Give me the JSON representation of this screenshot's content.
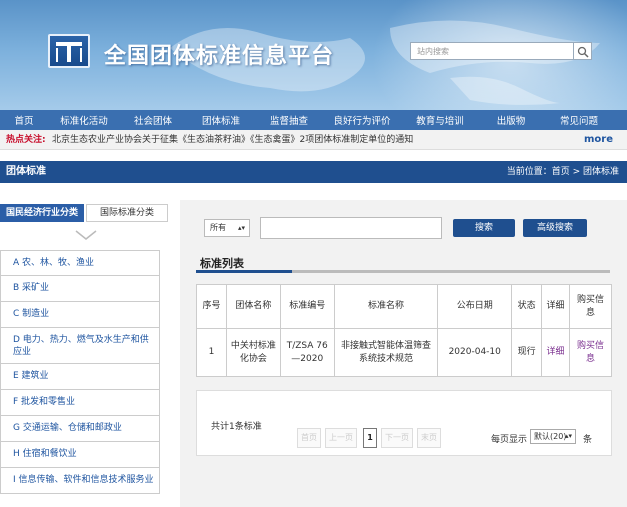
{
  "header": {
    "site_title": "全国团体标准信息平台",
    "search_placeholder": "站内搜索"
  },
  "nav": {
    "items": [
      "首页",
      "标准化活动",
      "社会团体",
      "团体标准",
      "监督抽查",
      "良好行为评价",
      "教育与培训",
      "出版物",
      "常见问题"
    ]
  },
  "hot": {
    "label": "热点关注:",
    "news": "北京生态农业产业协会关于征集《生态油茶籽油》《生态禽蛋》2项团体标准制定单位的通知",
    "more": "more"
  },
  "section": {
    "title": "团体标准",
    "breadcrumb": "当前位置：首页 > 团体标准"
  },
  "left": {
    "tab_active": "国民经济行业分类",
    "tab_inactive": "国际标准分类",
    "categories": [
      "A 农、林、牧、渔业",
      "B 采矿业",
      "C 制造业",
      "D 电力、热力、燃气及水生产和供应业",
      "E 建筑业",
      "F 批发和零售业",
      "G 交通运输、仓储和邮政业",
      "H 住宿和餐饮业",
      "I 信息传输、软件和信息技术服务业"
    ]
  },
  "search": {
    "scope": "所有",
    "search_btn": "搜索",
    "advanced_btn": "高级搜索"
  },
  "list": {
    "title": "标准列表",
    "headers": [
      "序号",
      "团体名称",
      "标准编号",
      "标准名称",
      "公布日期",
      "状态",
      "详细",
      "购买信息"
    ],
    "rows": [
      [
        "1",
        "中关村标准化协会",
        "T/ZSA 76—2020",
        "非接触式智能体温筛查系统技术规范",
        "2020-04-10",
        "现行",
        "详细",
        "购买信息"
      ]
    ]
  },
  "pager": {
    "total": "共计1条标准",
    "first": "首页",
    "prev": "上一页",
    "current": "1",
    "next": "下一页",
    "last": "末页",
    "per_page_label": "每页显示",
    "per_page_value": "默认(20)",
    "unit": "条"
  },
  "colors": {
    "nav_bg": "#3a6fb0",
    "section_bg": "#1f4f8f",
    "hot_label": "#c8102e",
    "link_blue": "#1f55a0"
  }
}
